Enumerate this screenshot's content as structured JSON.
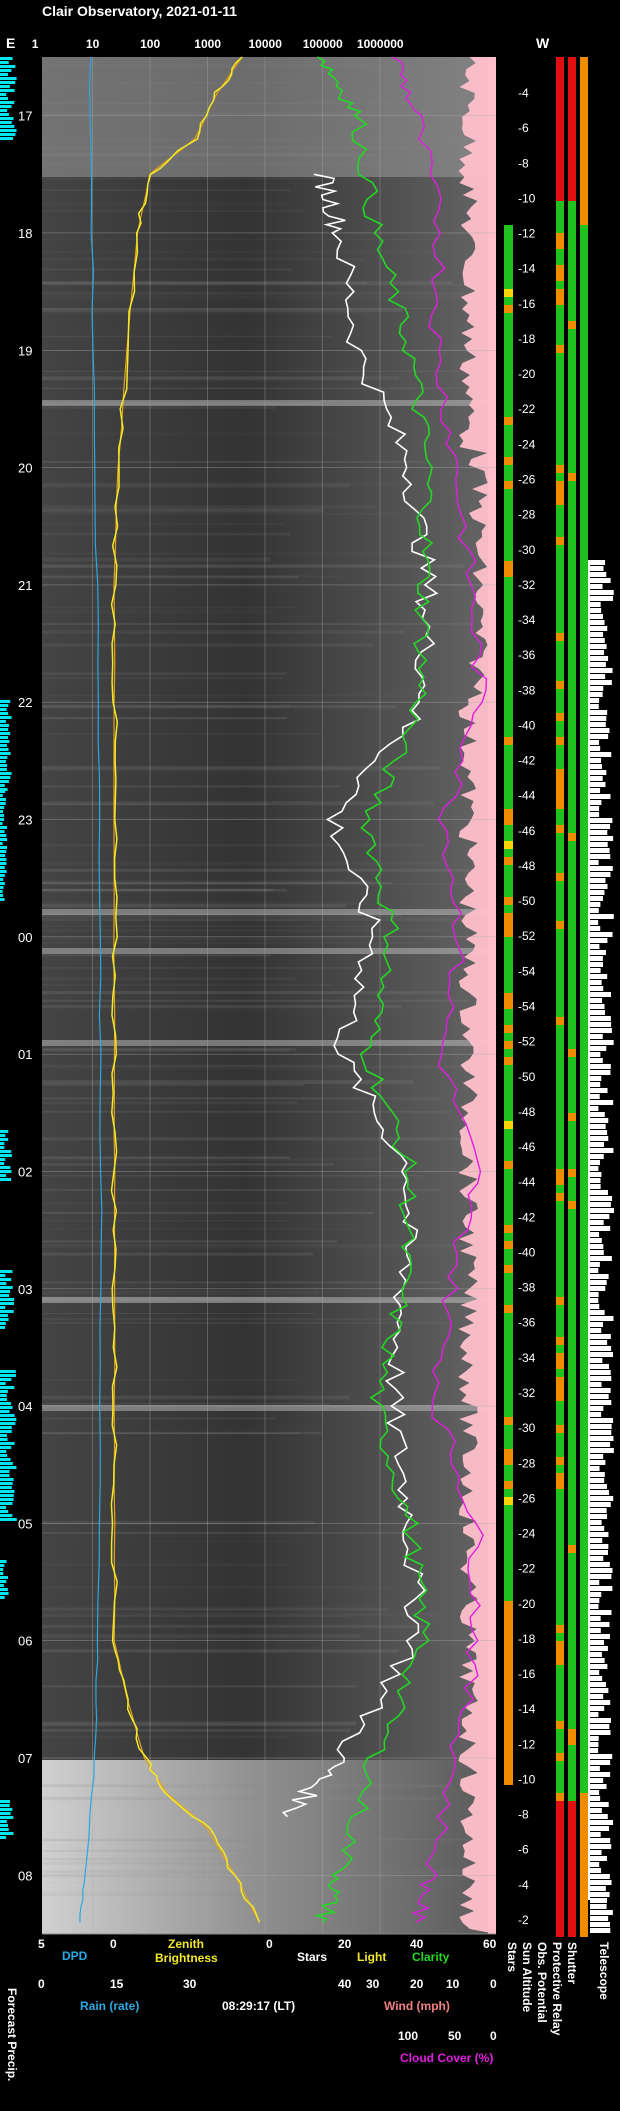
{
  "title": "Clair Observatory, 2021-01-11",
  "timestamp": "08:29:17 (LT)",
  "compass": {
    "east": "E",
    "west": "W"
  },
  "colors": {
    "dpd": "#2aa8e0",
    "zenith": "#f2e829",
    "model": "#e8a11a",
    "stars": "#ffffff",
    "clarity": "#22d822",
    "cloud": "#e21ce2",
    "pink": "#ffc0cb",
    "cyan": "#00e5ee",
    "green": "#1fc21f",
    "red": "#e01010",
    "orange": "#f08c00",
    "yellowbar": "#ffd400"
  },
  "top_axis": {
    "ticks": [
      "1",
      "10",
      "100",
      "1000",
      "10000",
      "100000",
      "1000000"
    ]
  },
  "time_axis": {
    "ticks": [
      "17",
      "18",
      "19",
      "20",
      "21",
      "22",
      "23",
      "00",
      "01",
      "02",
      "03",
      "04",
      "05",
      "06",
      "07",
      "08"
    ]
  },
  "sun_altitude": {
    "labels": [
      "-4",
      "-6",
      "-8",
      "-10",
      "-12",
      "-14",
      "-16",
      "-18",
      "-20",
      "-22",
      "-24",
      "-26",
      "-28",
      "-30",
      "-32",
      "-34",
      "-36",
      "-38",
      "-40",
      "-42",
      "-44",
      "-46",
      "-48",
      "-50",
      "-52",
      "-54",
      "-54",
      "-52",
      "-50",
      "-48",
      "-46",
      "-44",
      "-42",
      "-40",
      "-38",
      "-36",
      "-34",
      "-32",
      "-30",
      "-28",
      "-26",
      "-24",
      "-22",
      "-20",
      "-18",
      "-16",
      "-14",
      "-12",
      "-10",
      "-8",
      "-6",
      "-4",
      "-2"
    ]
  },
  "bottom_axes": {
    "dpd_ticks": [
      "5",
      "0"
    ],
    "dpd_label": "DPD",
    "rain_ticks": [
      "0",
      "15",
      "30"
    ],
    "rain_label": "Rain (rate)",
    "zenith_label_1": "Zenith",
    "zenith_label_2": "Brightness",
    "stars_ticks": [
      "0",
      "20",
      "40",
      "60"
    ],
    "stars_label": "Stars",
    "light_label": "Light",
    "clarity_label": "Clarity",
    "wind_ticks": [
      "40",
      "30",
      "20",
      "10",
      "0"
    ],
    "wind_label": "Wind (mph)",
    "cloud_ticks": [
      "100",
      "50",
      "0"
    ],
    "cloud_label": "Cloud Cover (%)"
  },
  "column_labels": {
    "forecast": "Forecast Precip.",
    "stars": "Stars",
    "sun_altitude": "Sun Altitude",
    "obs_potential": "Obs. Potential",
    "protective": "Protective Relay",
    "shutter": "Shutter",
    "telescope": "Telescope"
  },
  "chart_data": {
    "type": "line",
    "title": "Clair Observatory, 2021-01-11",
    "time_range": [
      "16:00",
      "08:30"
    ],
    "time_ticks": [
      "17",
      "18",
      "19",
      "20",
      "21",
      "22",
      "23",
      "00",
      "01",
      "02",
      "03",
      "04",
      "05",
      "06",
      "07",
      "08"
    ],
    "top_axis_log": [
      1,
      10,
      100,
      1000,
      10000,
      100000,
      1000000
    ],
    "series": [
      {
        "name": "Zenith Brightness",
        "x_hours": [
          16.5,
          16.8,
          17.2,
          17.5,
          18.0,
          19.0,
          20.0,
          21.0,
          22.0,
          23.0,
          0.0,
          1.0,
          2.0,
          3.0,
          4.0,
          5.0,
          6.0,
          6.5,
          7.0,
          7.3,
          7.6,
          8.0,
          8.4
        ],
        "values": [
          4000,
          1500,
          600,
          100,
          60,
          40,
          28,
          24,
          24,
          24,
          24,
          24,
          24,
          24,
          24,
          24,
          24,
          40,
          80,
          200,
          1000,
          3000,
          8000
        ]
      },
      {
        "name": "Stars",
        "x_hours": [
          17.5,
          18.0,
          19.0,
          20.0,
          21.0,
          22.0,
          23.0,
          0.0,
          1.0,
          2.0,
          3.0,
          4.0,
          5.0,
          6.0,
          7.0,
          7.5
        ],
        "values": [
          15,
          20,
          25,
          40,
          45,
          44,
          18,
          30,
          20,
          40,
          38,
          35,
          40,
          42,
          20,
          5
        ]
      },
      {
        "name": "Clarity",
        "x_hours": [
          16.5,
          17.0,
          18.0,
          19.0,
          20.0,
          21.0,
          22.0,
          23.0,
          0.0,
          1.0,
          2.0,
          3.0,
          4.0,
          5.0,
          6.0,
          7.0,
          8.0,
          8.4
        ],
        "values": [
          15,
          25,
          30,
          40,
          45,
          44,
          43,
          28,
          35,
          28,
          40,
          38,
          30,
          40,
          44,
          30,
          20,
          15
        ]
      },
      {
        "name": "Cloud Cover (%)",
        "x_hours": [
          16.5,
          17.0,
          18.0,
          19.0,
          20.0,
          21.0,
          22.0,
          23.0,
          0.0,
          1.0,
          2.0,
          3.0,
          4.0,
          5.0,
          6.0,
          7.0,
          8.0,
          8.4
        ],
        "values": [
          100,
          80,
          55,
          60,
          40,
          25,
          15,
          50,
          35,
          55,
          20,
          45,
          60,
          20,
          20,
          40,
          65,
          80
        ]
      },
      {
        "name": "DPD",
        "x_hours": [
          16.5,
          18.0,
          20.0,
          22.0,
          0.0,
          2.0,
          4.0,
          6.0,
          7.0,
          8.0,
          8.4
        ],
        "values": [
          2.5,
          2.3,
          2.0,
          1.6,
          1.5,
          1.4,
          1.5,
          1.7,
          2.0,
          3.0,
          3.5
        ]
      }
    ],
    "grid": true
  }
}
